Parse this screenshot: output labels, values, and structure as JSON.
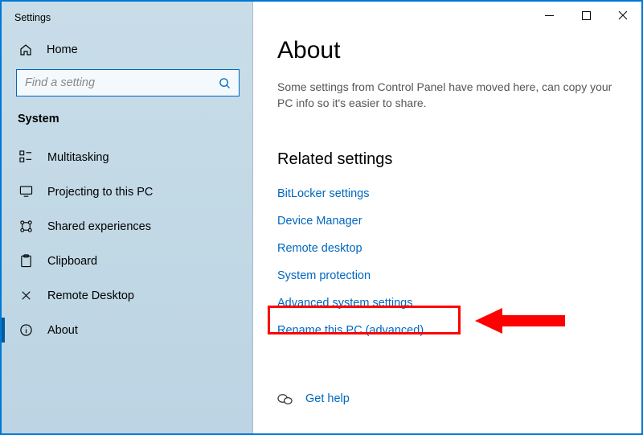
{
  "window_title": "Settings",
  "home_label": "Home",
  "search_placeholder": "Find a setting",
  "group_header": "System",
  "nav_items": [
    {
      "icon": "multitasking-icon",
      "label": "Multitasking"
    },
    {
      "icon": "projecting-icon",
      "label": "Projecting to this PC"
    },
    {
      "icon": "shared-icon",
      "label": "Shared experiences"
    },
    {
      "icon": "clipboard-icon",
      "label": "Clipboard"
    },
    {
      "icon": "remote-icon",
      "label": "Remote Desktop"
    },
    {
      "icon": "about-icon",
      "label": "About",
      "selected": true
    }
  ],
  "page_title": "About",
  "page_description": "Some settings from Control Panel have moved here, can copy your PC info so it's easier to share.",
  "related_heading": "Related settings",
  "related_links": [
    "BitLocker settings",
    "Device Manager",
    "Remote desktop",
    "System protection",
    "Advanced system settings",
    "Rename this PC (advanced)"
  ],
  "highlighted_link_index": 4,
  "help_label": "Get help"
}
